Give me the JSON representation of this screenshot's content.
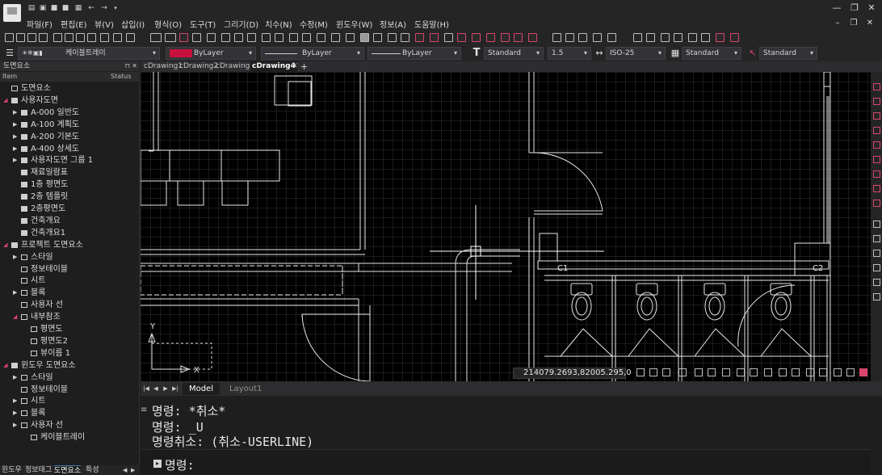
{
  "menu": [
    "파일(F)",
    "편집(E)",
    "뷰(V)",
    "삽입(I)",
    "형식(O)",
    "도구(T)",
    "그리기(D)",
    "치수(N)",
    "수정(M)",
    "윈도우(W)",
    "정보(A)",
    "도움말(H)"
  ],
  "properties": {
    "layer": "케이블트레이",
    "color": "ByLayer",
    "color_hex": "#c8103e",
    "linetype": "ByLayer",
    "lineweight": "ByLayer",
    "text_style": "Standard",
    "text_height": "1.5",
    "dim_style": "ISO-25",
    "table_style": "Standard",
    "multileader_style": "Standard"
  },
  "panel": {
    "title": "도면요소",
    "col_item": "Item",
    "col_status": "Status",
    "tree": [
      "도면요소",
      "사용자도면",
      "A-000 일반도",
      "A-100 계획도",
      "A-200 기본도",
      "A-400 상세도",
      "사용자도면 그룹 1",
      "재료일람표",
      "1층 평면도",
      "2층 템플릿",
      "2층평면도",
      "건축개요",
      "건축개요1",
      "프로젝트 도면요소",
      "스타일",
      "정보테이블",
      "시트",
      "블록",
      "사용자 선",
      "내부참조",
      "평면도",
      "평면도2",
      "뷰이름 1",
      "윈도우 도면요소",
      "스타일",
      "정보테이블",
      "시트",
      "블록",
      "사용자 선",
      "케이블트레이"
    ],
    "tabs": [
      "윈도우",
      "정보태그",
      "도면요소",
      "특성"
    ]
  },
  "doc_tabs": [
    "cDrawing1",
    "cDrawing2",
    "cDrawing3",
    "cDrawing4"
  ],
  "drawing": {
    "labels": [
      "C1",
      "C2"
    ],
    "ucs_y": "Y",
    "ucs_x": "X",
    "coord_readout": "214079.2693,82005.295,0"
  },
  "layout_tabs": [
    "Model",
    "Layout1"
  ],
  "command": {
    "history": [
      "명령: *취소*",
      "명령: _U",
      "명령취소: (취소-USERLINE)"
    ],
    "prompt": "명령:",
    "input_value": ""
  },
  "colors": {
    "accent": "#d9456b",
    "background": "#000000",
    "chrome": "#252526"
  }
}
